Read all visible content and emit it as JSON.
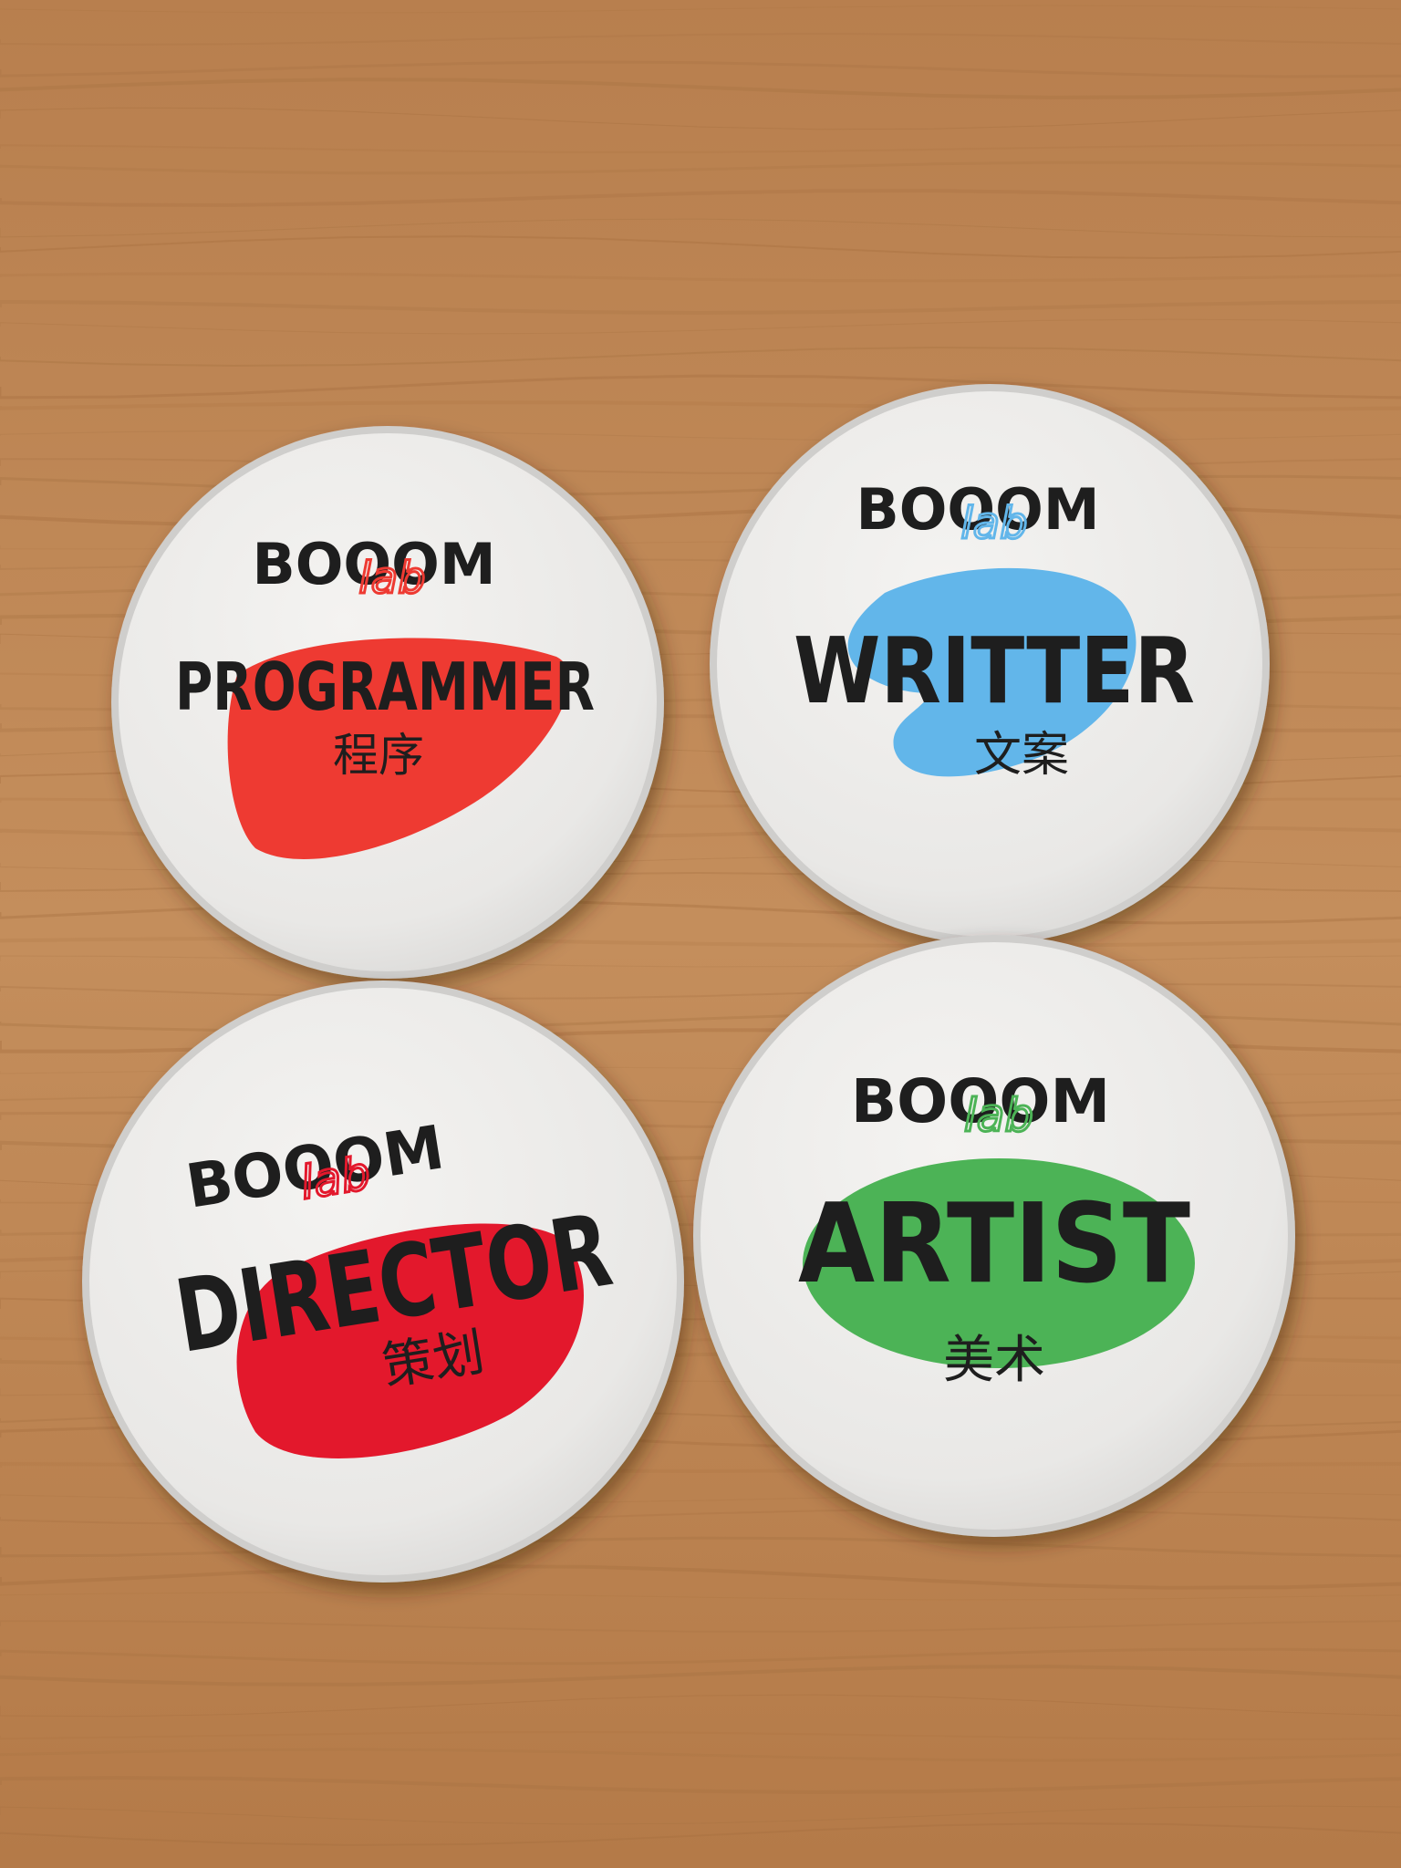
{
  "background": {
    "material": "wooden table",
    "color": "#c08a58",
    "grain": "#a56f3f"
  },
  "badges": [
    {
      "brand": "BOOOM",
      "script": "lab",
      "role": "PROGRAMMER",
      "role_cn": "程序",
      "accent": "#ee3a32"
    },
    {
      "brand": "BOOOM",
      "script": "lab",
      "role": "WRITTER",
      "role_cn": "文案",
      "accent": "#62b6ea"
    },
    {
      "brand": "BOOOM",
      "script": "lab",
      "role": "DIRECTOR",
      "role_cn": "策划",
      "accent": "#e3182c"
    },
    {
      "brand": "BOOOM",
      "script": "lab",
      "role": "ARTIST",
      "role_cn": "美术",
      "accent": "#4cb356"
    }
  ]
}
